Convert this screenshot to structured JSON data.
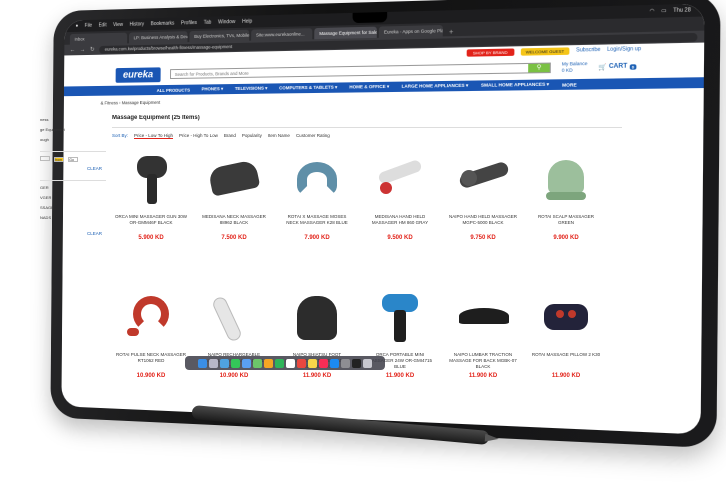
{
  "menubar": {
    "items": [
      "File",
      "Edit",
      "View",
      "History",
      "Bookmarks",
      "Profiles",
      "Tab",
      "Window",
      "Help"
    ],
    "clock": "Thu 28"
  },
  "browser": {
    "tabs": [
      {
        "label": "Inbox",
        "active": false
      },
      {
        "label": "LP: Business Analysis & Develop",
        "active": false
      },
      {
        "label": "Buy Electronics, TVs, Mobile",
        "active": false
      },
      {
        "label": "Site:www.eurekaonline...",
        "active": false
      },
      {
        "label": "Massage Equipment for Sale",
        "active": true
      },
      {
        "label": "Eureka - Apps on Google Play",
        "active": false
      }
    ],
    "url": "eureka.com.kw/products/browse/health-fitness/massage-equipment"
  },
  "site": {
    "shop_by_brand": "SHOP BY BRAND",
    "welcome": "WELCOME GUEST",
    "subscribe": "Subscribe",
    "login": "Login/Sign up",
    "search_placeholder": "Search for Products, Brands and More",
    "balance_label": "My Balance",
    "balance_value": "0 KD",
    "cart_label": "CART",
    "cart_count": "0",
    "nav": [
      "ALL PRODUCTS",
      "PHONES ▾",
      "TELEVISIONS ▾",
      "COMPUTERS & TABLETS ▾",
      "HOME & OFFICE ▾",
      "LARGE HOME APPLIANCES ▾",
      "SMALL HOME APPLIANCES ▾",
      "MORE"
    ]
  },
  "breadcrumb": "& Fitness › Massage Equipment",
  "sidebar": {
    "clear1": "CLEAR",
    "clear2": "CLEAR",
    "go": "Go",
    "from": "from",
    "lines": [
      "ness",
      "ge Equipment",
      "ough",
      "",
      "",
      "GER",
      "VGER",
      "SSAGE",
      "NADS"
    ]
  },
  "main": {
    "title": "Massage Equipment (25 Items)",
    "sort_label": "Sort By:",
    "sort_options": [
      "Price - Low To High",
      "Price - High To Low",
      "Brand",
      "Popularity",
      "Item Name",
      "Customer Rating"
    ]
  },
  "products": [
    {
      "name": "ORCA MINI MASSAGER GUN 30W OR-GMM46F BLACK",
      "price": "5.900 KD",
      "icon": "massage-gun-icon"
    },
    {
      "name": "MEDISANA NECK MASSAGER 88962 BLACK",
      "price": "7.500 KD",
      "icon": "neck-massager-icon"
    },
    {
      "name": "ROTAI X MASSAGE MOSES NECK MASSAGER K28 BLUE",
      "price": "7.900 KD",
      "icon": "neck-pillow-icon"
    },
    {
      "name": "MEDISANA HAND HELD MASSAGER HM 860 GRAY",
      "price": "9.500 KD",
      "icon": "handheld-massager-icon"
    },
    {
      "name": "NAIPO HAND HELD MASSAGER MGPC-5000 BLACK",
      "price": "9.750 KD",
      "icon": "handheld-massager-icon"
    },
    {
      "name": "ROTAI SCALP MASSAGER GREEN",
      "price": "9.900 KD",
      "icon": "scalp-massager-icon"
    },
    {
      "name": "ROTAI PULSE NECK MASSAGER RT1062 RED",
      "price": "10.900 KD",
      "icon": "pulse-neck-icon"
    },
    {
      "name": "NAIPO RECHARGEABLE HANDHELD MASSAGER BT-0128 GREY",
      "price": "10.900 KD",
      "icon": "handheld-massager-icon"
    },
    {
      "name": "NAIPO SHIATSU FOOT MASSAGER WITH HEAT MGF-1005 BLACK",
      "price": "11.900 KD",
      "icon": "foot-massager-icon"
    },
    {
      "name": "ORCA PORTABLE MINI MASSAGER 24W OR-GMI4715 BLUE",
      "price": "11.900 KD",
      "icon": "massage-gun-icon"
    },
    {
      "name": "NAIPO LUMBAR TRACTION MASSAGE FOR BACK MGBK-07 BLACK",
      "price": "11.900 KD",
      "icon": "lumbar-massager-icon"
    },
    {
      "name": "ROTAI MASSAGE PILLOW 2 K30",
      "price": "11.900 KD",
      "icon": "massage-pillow-icon"
    }
  ],
  "colors": {
    "brand_blue": "#1a56b4",
    "price_red": "#e2231a",
    "search_green": "#7ac143"
  }
}
